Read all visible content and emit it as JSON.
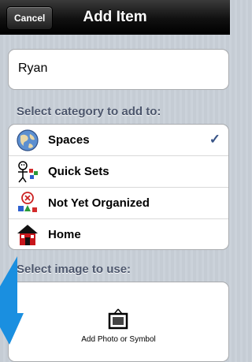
{
  "navbar": {
    "title": "Add Item",
    "cancel_label": "Cancel"
  },
  "name_field": {
    "value": "Ryan"
  },
  "category_section": {
    "header": "Select category to add to:",
    "items": [
      {
        "label": "Spaces",
        "icon": "globe-icon",
        "selected": true
      },
      {
        "label": "Quick Sets",
        "icon": "quick-sets-icon",
        "selected": false
      },
      {
        "label": "Not Yet Organized",
        "icon": "shapes-icon",
        "selected": false
      },
      {
        "label": "Home",
        "icon": "house-icon",
        "selected": false
      }
    ],
    "checkmark": "✓"
  },
  "image_section": {
    "header": "Select image to use:",
    "add_label": "Add Photo or Symbol",
    "icon": "picture-frame-icon"
  },
  "colors": {
    "navbar": "#111111",
    "section_header": "#4c566c",
    "checkmark": "#385487",
    "arrow": "#1a8fe0"
  }
}
